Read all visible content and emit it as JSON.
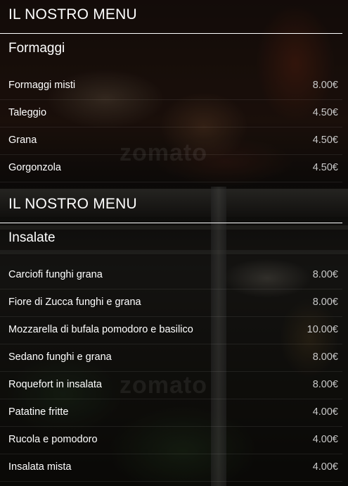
{
  "sections": [
    {
      "heading": "IL NOSTRO MENU",
      "category": "Formaggi",
      "items": [
        {
          "name": "Formaggi misti",
          "price": "8.00€"
        },
        {
          "name": "Taleggio",
          "price": "4.50€"
        },
        {
          "name": "Grana",
          "price": "4.50€"
        },
        {
          "name": "Gorgonzola",
          "price": "4.50€"
        }
      ]
    },
    {
      "heading": "IL NOSTRO MENU",
      "category": "Insalate",
      "items": [
        {
          "name": "Carciofi funghi grana",
          "price": "8.00€"
        },
        {
          "name": "Fiore di Zucca funghi e grana",
          "price": "8.00€"
        },
        {
          "name": "Mozzarella di bufala pomodoro e basilico",
          "price": "10.00€"
        },
        {
          "name": "Sedano funghi e grana",
          "price": "8.00€"
        },
        {
          "name": "Roquefort in insalata",
          "price": "8.00€"
        },
        {
          "name": "Patatine fritte",
          "price": "4.00€"
        },
        {
          "name": "Rucola e pomodoro",
          "price": "4.00€"
        },
        {
          "name": "Insalata mista",
          "price": "4.00€"
        }
      ]
    }
  ],
  "watermark": "zomato"
}
